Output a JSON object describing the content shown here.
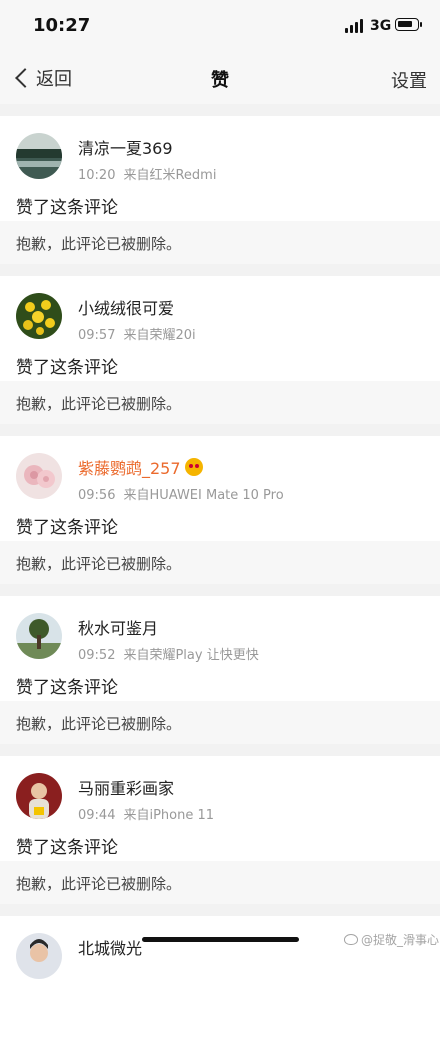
{
  "status_bar": {
    "time": "10:27",
    "network": "3G",
    "battery_level": 0.8
  },
  "nav": {
    "back_label": "返回",
    "title": "赞",
    "settings_label": "设置"
  },
  "items": [
    {
      "username": "清凉一夏369",
      "time": "10:20",
      "source": "来自红米Redmi",
      "action": "赞了这条评论",
      "comment": "抱歉，此评论已被删除。",
      "avatar_icon": "lake-landscape",
      "vip": false
    },
    {
      "username": "小绒绒很可爱",
      "time": "09:57",
      "source": "来自荣耀20i",
      "action": "赞了这条评论",
      "comment": "抱歉，此评论已被删除。",
      "avatar_icon": "yellow-flowers",
      "vip": false
    },
    {
      "username": "紫藤鹦鹉_257",
      "time": "09:56",
      "source": "来自HUAWEI Mate 10 Pro",
      "action": "赞了这条评论",
      "comment": "抱歉，此评论已被删除。",
      "avatar_icon": "pink-roses",
      "vip": true
    },
    {
      "username": "秋水可鉴月",
      "time": "09:52",
      "source": "来自荣耀Play 让快更快",
      "action": "赞了这条评论",
      "comment": "抱歉，此评论已被删除。",
      "avatar_icon": "tree-landscape",
      "vip": false
    },
    {
      "username": "马丽重彩画家",
      "time": "09:44",
      "source": "来自iPhone 11",
      "action": "赞了这条评论",
      "comment": "抱歉，此评论已被删除。",
      "avatar_icon": "child-portrait",
      "vip": false
    },
    {
      "username": "北城微光",
      "avatar_icon": "person-portrait",
      "vip": false
    }
  ],
  "watermark": "@捉敬_滑事心",
  "colors": {
    "vip_name": "#eb6a2d",
    "meta": "#999999",
    "background": "#f2f2f2"
  }
}
